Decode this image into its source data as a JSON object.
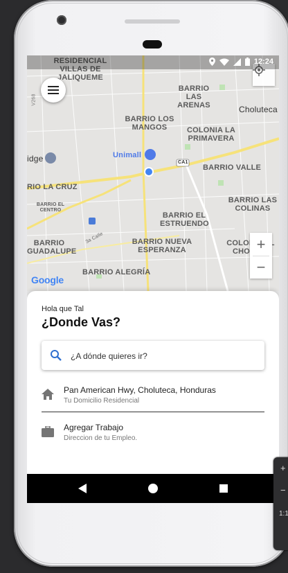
{
  "status_bar": {
    "time": "12:24",
    "icons": [
      "location-icon",
      "wifi-icon",
      "signal-icon",
      "battery-icon"
    ]
  },
  "map": {
    "labels": [
      "RESIDENCIAL VILLAS DE JALIQUEME",
      "BARRIO LAS ARENAS",
      "Choluteca",
      "BARRIO LOS MANGOS",
      "COLONIA LA PRIMAVERA",
      "Unimall",
      "CA1",
      "BARRIO VALLE",
      "RIO LA CRUZ",
      "BARRIO EL CENTRO",
      "BARRIO LAS COLINAS",
      "BARRIO EL ESTRUENDO",
      "BARRIO GUADALUPE",
      "BARRIO NUEVA ESPERANZA",
      "COLONIA EL CHORIZO",
      "BARRIO ALEGRÍA",
      "3a Calle",
      "V268",
      "idge"
    ],
    "google_logo": "Google",
    "zoom_in": "+",
    "zoom_out": "−"
  },
  "sheet": {
    "greeting": "Hola que Tal",
    "headline": "¿Donde Vas?",
    "search_placeholder": "¿A dónde quieres ir?",
    "places": [
      {
        "icon": "home-icon",
        "title": "Pan American Hwy, Choluteca, Honduras",
        "subtitle": "Tu Domicilio Residencial"
      },
      {
        "icon": "briefcase-icon",
        "title": "Agregar Trabajo",
        "subtitle": "Direccion de tu Empleo."
      }
    ]
  },
  "side_toolbar": {
    "items": [
      "+",
      "−",
      "1:1"
    ]
  }
}
